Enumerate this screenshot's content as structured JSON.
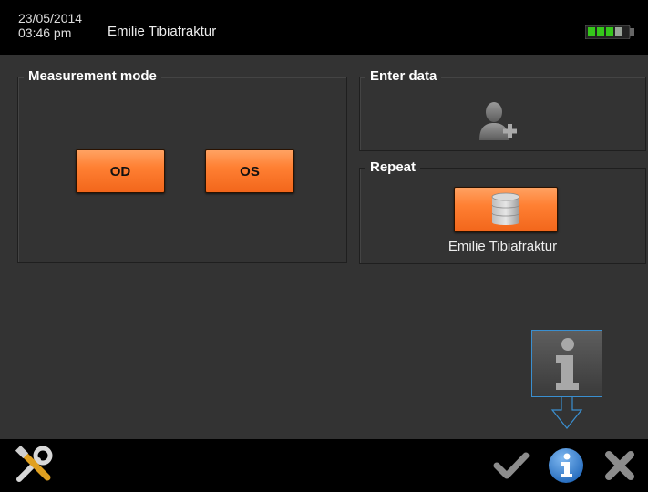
{
  "header": {
    "date": "23/05/2014",
    "time": "03:46 pm",
    "patient_name": "Emilie Tibiafraktur",
    "battery_icon": "battery-icon"
  },
  "measurement_mode": {
    "title": "Measurement mode",
    "od_label": "OD",
    "os_label": "OS"
  },
  "enter_data": {
    "title": "Enter data",
    "icon": "add-user-icon"
  },
  "repeat": {
    "title": "Repeat",
    "icon": "database-icon",
    "patient_name": "Emilie Tibiafraktur"
  },
  "footer": {
    "icons": [
      "tools-icon",
      "check-icon",
      "info-icon",
      "close-icon"
    ]
  },
  "colors": {
    "accent_orange": "#ff8033",
    "info_blue": "#1e6fc4",
    "battery_green": "#35c61b",
    "panel_bg": "#333333"
  }
}
